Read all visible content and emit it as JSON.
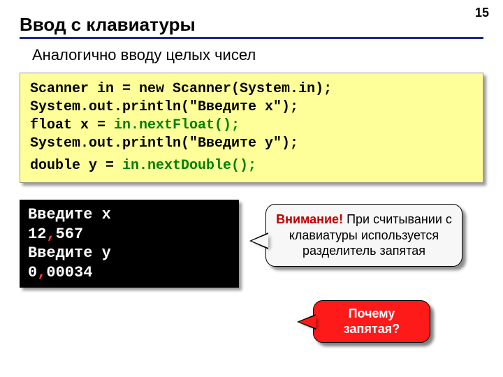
{
  "page_number": "15",
  "title": "Ввод с клавиатуры",
  "subtitle": "Аналогично вводу целых чисел",
  "code": {
    "line1_a": "Scanner in = new Scanner(System.in);",
    "line2_a": "System.out.println(\"Введите x\");",
    "line3_a": "float x = ",
    "line3_b": "in.nextFloat();",
    "line4_a": "System.out.println(\"Введите y\");",
    "line5_a": "double y = ",
    "line5_b": "in.nextDouble();"
  },
  "console": {
    "l1": "Введите x",
    "l2a": "12",
    "l2b": ",",
    "l2c": "567",
    "l3": "Введите y",
    "l4a": "0",
    "l4b": ",",
    "l4c": "00034"
  },
  "callout_white": {
    "emph": "Внимание!",
    "rest": " При считывании с клавиатуры используется разделитель запятая"
  },
  "callout_red": {
    "l1": "Почему",
    "l2": "запятая?"
  }
}
